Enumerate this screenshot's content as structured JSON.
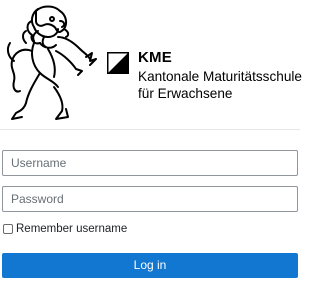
{
  "header": {
    "logo": {
      "image": "zurich-lion-icon",
      "flag": "zurich-flag-icon",
      "abbrev": "KME",
      "name_line1": "Kantonale Maturitätsschule",
      "name_line2": "für Erwachsene"
    }
  },
  "login": {
    "username_placeholder": "Username",
    "username_value": "",
    "password_placeholder": "Password",
    "password_value": "",
    "remember_label": "Remember username",
    "remember_checked": false,
    "submit_label": "Log in"
  },
  "colors": {
    "primary": "#1177d1",
    "field_border": "#8f959a",
    "placeholder": "#666f76",
    "text": "#1d2125"
  }
}
